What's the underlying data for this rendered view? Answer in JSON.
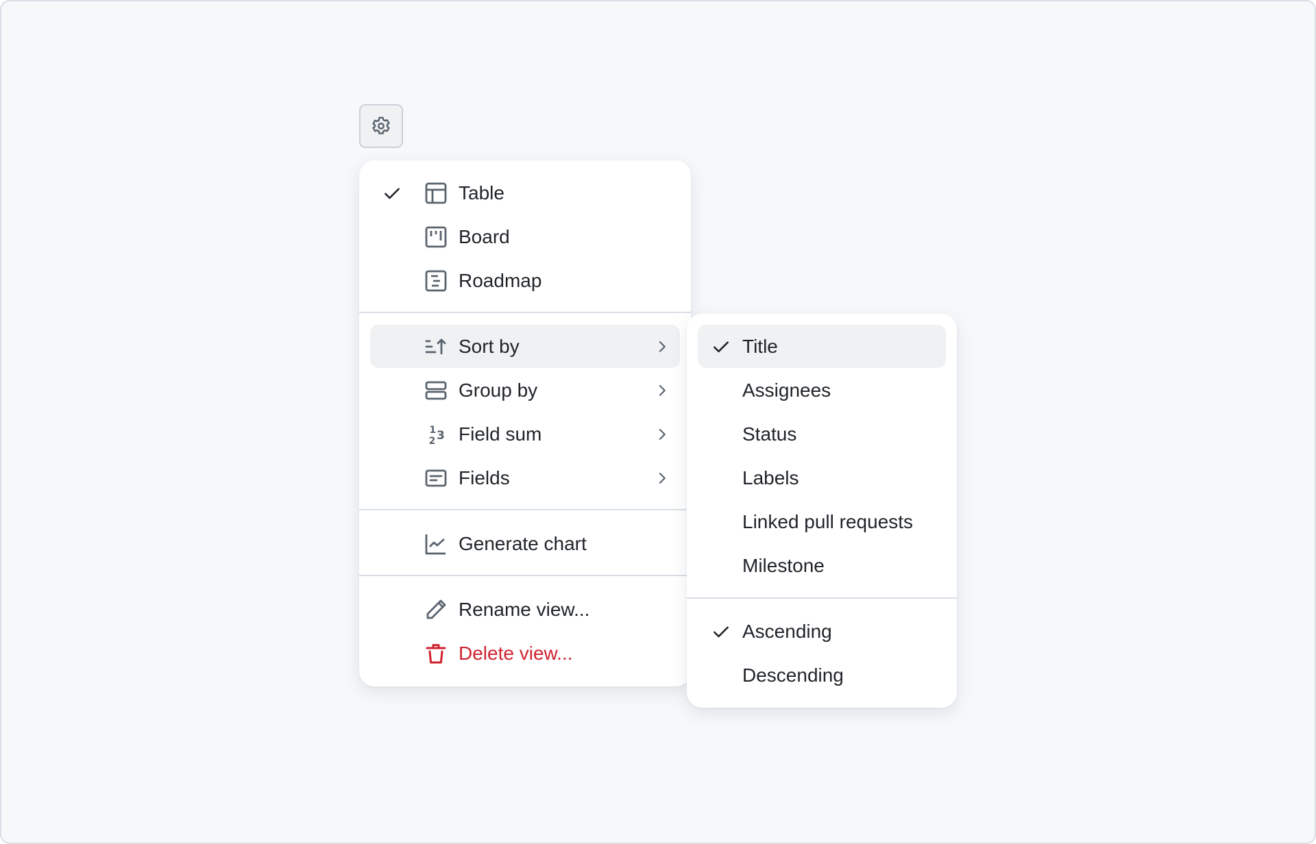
{
  "toolbar": {
    "settings_icon": "gear-icon"
  },
  "main_menu": {
    "layouts": [
      {
        "label": "Table",
        "icon": "table-icon",
        "checked": true
      },
      {
        "label": "Board",
        "icon": "board-icon",
        "checked": false
      },
      {
        "label": "Roadmap",
        "icon": "roadmap-icon",
        "checked": false
      }
    ],
    "config": [
      {
        "label": "Sort by",
        "icon": "sort-asc-icon",
        "has_submenu": true,
        "active": true
      },
      {
        "label": "Group by",
        "icon": "rows-icon",
        "has_submenu": true
      },
      {
        "label": "Field sum",
        "icon": "number-icon",
        "has_submenu": true
      },
      {
        "label": "Fields",
        "icon": "note-icon",
        "has_submenu": true
      }
    ],
    "chart": {
      "label": "Generate chart",
      "icon": "graph-icon"
    },
    "actions": [
      {
        "label": "Rename view...",
        "icon": "pencil-icon"
      },
      {
        "label": "Delete view...",
        "icon": "trash-icon",
        "danger": true
      }
    ]
  },
  "sort_submenu": {
    "fields": [
      {
        "label": "Title",
        "checked": true
      },
      {
        "label": "Assignees",
        "checked": false
      },
      {
        "label": "Status",
        "checked": false
      },
      {
        "label": "Labels",
        "checked": false
      },
      {
        "label": "Linked pull requests",
        "checked": false
      },
      {
        "label": "Milestone",
        "checked": false
      }
    ],
    "directions": [
      {
        "label": "Ascending",
        "checked": true
      },
      {
        "label": "Descending",
        "checked": false
      }
    ]
  },
  "colors": {
    "text": "#1f2328",
    "icon": "#59636e",
    "danger": "#cf222e",
    "active_bg": "#eff1f3",
    "background": "#f6f8fa"
  }
}
